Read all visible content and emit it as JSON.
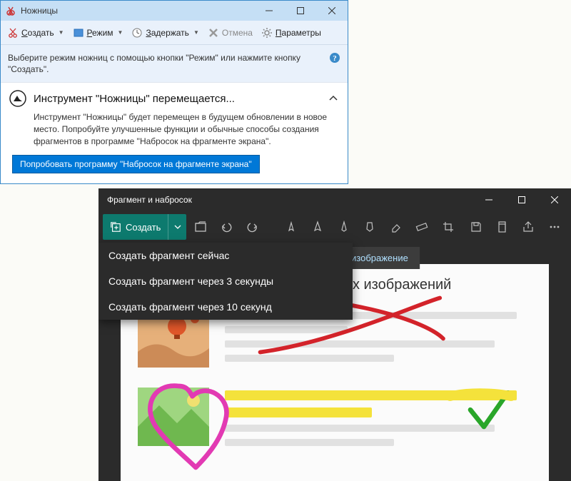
{
  "sniptool": {
    "title": "Ножницы",
    "toolbar": {
      "new_label": "Создать",
      "mode_label": "Режим",
      "delay_label": "Задержать",
      "cancel_label": "Отмена",
      "options_label": "Параметры"
    },
    "info_msg": "Выберите режим ножниц с помощью кнопки \"Режим\" или нажмите кнопку \"Создать\".",
    "panel": {
      "title": "Инструмент \"Ножницы\" перемещается...",
      "body": "Инструмент \"Ножницы\" будет перемещен в будущем обновлении в новое место. Попробуйте улучшенные функции и обычные способы создания фрагментов в программе \"Набросок на фрагменте экрана\".",
      "button": "Попробовать программу \"Набросок на фрагменте экрана\""
    }
  },
  "sketch": {
    "title": "Фрагмент и набросок",
    "new_label": "Создать",
    "menu": {
      "now": "Создать фрагмент сейчас",
      "in3": "Создать фрагмент через 3 секунды",
      "in10": "Создать фрагмент через 10 секунд"
    },
    "banner": "ойте существующее изображение",
    "headline_partial": "ка и передача любых изображений"
  }
}
